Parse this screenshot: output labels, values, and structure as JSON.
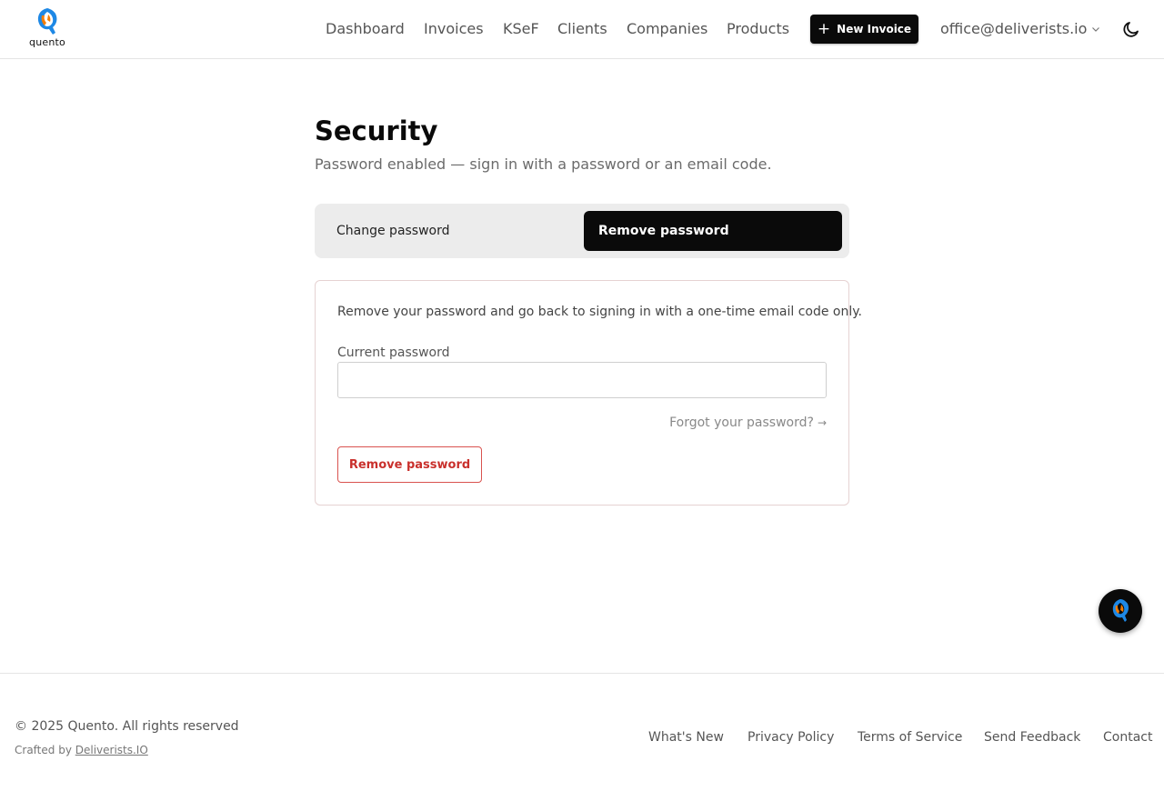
{
  "header": {
    "logo_text": "quento",
    "nav": [
      "Dashboard",
      "Invoices",
      "KSeF",
      "Clients",
      "Companies",
      "Products"
    ],
    "new_invoice_label": "New Invoice",
    "account_email": "office@deliverists.io"
  },
  "main": {
    "title": "Security",
    "subtitle": "Password enabled — sign in with a password or an email code.",
    "tabs": [
      {
        "label": "Change password",
        "active": false
      },
      {
        "label": "Remove password",
        "active": true
      }
    ],
    "card": {
      "description": "Remove your password and go back to signing in with a one-time email code only.",
      "current_password_label": "Current password",
      "current_password_value": "",
      "forgot_label": "Forgot your password?",
      "forgot_arrow": "→",
      "remove_button_label": "Remove password"
    }
  },
  "footer": {
    "copyright": "© 2025 Quento. All rights reserved",
    "crafted_prefix": "Crafted by ",
    "crafted_link": "Deliverists.IO",
    "links": [
      "What's New",
      "Privacy Policy",
      "Terms of Service",
      "Send Feedback",
      "Contact"
    ]
  },
  "colors": {
    "primary": "#0a0a0a",
    "danger": "#c9302c",
    "logo_blue": "#1e88e5",
    "logo_orange": "#f57c00"
  },
  "icons": {
    "logo": "quento-logo-icon",
    "plus": "plus-icon",
    "chevron": "chevron-down-icon",
    "theme": "moon-icon",
    "assistant": "assistant-icon"
  }
}
